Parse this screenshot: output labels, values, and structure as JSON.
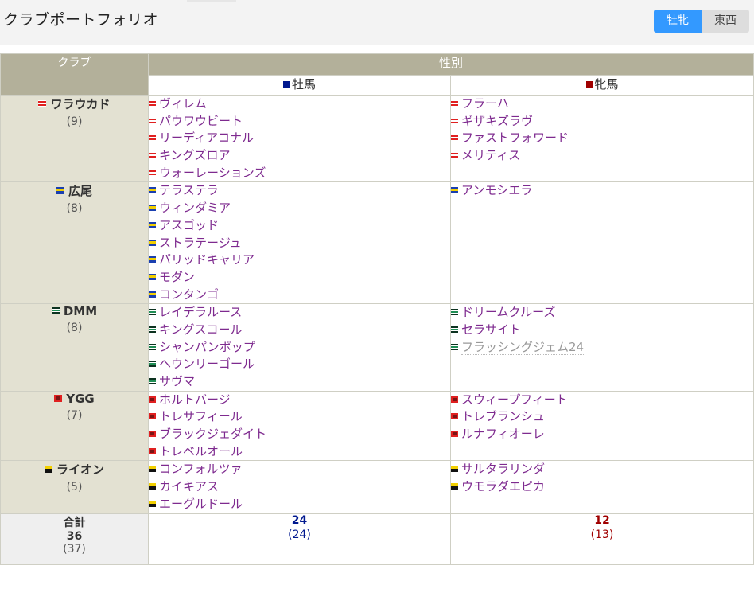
{
  "page_title": "クラブポートフォリオ",
  "toggle": {
    "options": [
      "牡牝",
      "東西"
    ],
    "active": "牡牝"
  },
  "table": {
    "club_header": "クラブ",
    "group_header": "性別",
    "col_male": "牡馬",
    "col_female": "牝馬",
    "colors": {
      "male": "#00188f",
      "female": "#a00000",
      "horse_link": "#7e2a8f",
      "header_bg": "#b3b09a",
      "club_bg": "#e3e1d2"
    },
    "clubs": [
      {
        "name": "ワラウカド",
        "count": "(9)",
        "flag": "waraukado",
        "male": [
          "ヴィレム",
          "パウワウビート",
          "リーディアコナル",
          "キングズロア",
          "ウォーレーションズ"
        ],
        "female": [
          "フラーハ",
          "ギザキズラヴ",
          "ファストフォワード",
          "メリティス"
        ]
      },
      {
        "name": "広尾",
        "count": "(8)",
        "flag": "hiroo",
        "male": [
          "テラステラ",
          "ウィンダミア",
          "アスゴッド",
          "ストラテージュ",
          "パリッドキャリア",
          "モダン",
          "コンタンゴ"
        ],
        "female": [
          "アンモシエラ"
        ]
      },
      {
        "name": "DMM",
        "count": "(8)",
        "flag": "dmm",
        "male": [
          "レイデラルース",
          "キングスコール",
          "シャンパンポップ",
          "ヘウンリーゴール",
          "サヴマ"
        ],
        "female": [
          "ドリームクルーズ",
          "セラサイト",
          "フラッシングジェム24"
        ],
        "female_muted": [
          false,
          false,
          true
        ]
      },
      {
        "name": "YGG",
        "count": "(7)",
        "flag": "ygg",
        "male": [
          "ホルトバージ",
          "トレサフィール",
          "ブラックジェダイト",
          "トレベルオール"
        ],
        "female": [
          "スウィープフィート",
          "トレブランシュ",
          "ルナフィオーレ"
        ]
      },
      {
        "name": "ライオン",
        "count": "(5)",
        "flag": "lion",
        "male": [
          "コンフォルツァ",
          "カイキアス",
          "エーグルドール"
        ],
        "female": [
          "サルタラリンダ",
          "ウモラダエピカ"
        ]
      }
    ],
    "totals": {
      "label": "合計",
      "all": "36",
      "all_sub": "(37)",
      "male": "24",
      "male_sub": "(24)",
      "female": "12",
      "female_sub": "(13)"
    }
  }
}
